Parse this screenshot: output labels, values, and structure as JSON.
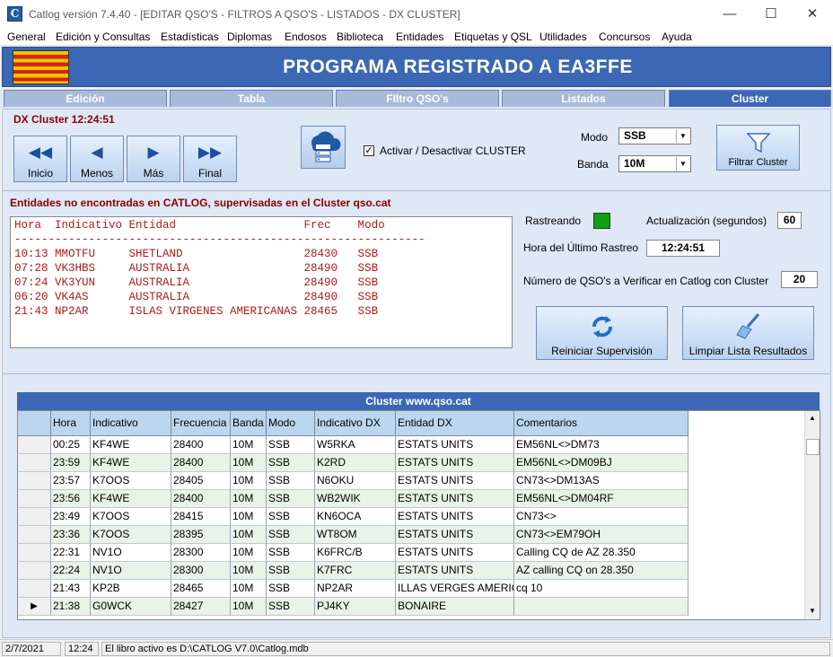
{
  "window": {
    "title": "Catlog versión 7.4.40 - [EDITAR QSO'S  - FILTROS A QSO'S - LISTADOS -  DX CLUSTER]",
    "app_icon": "C"
  },
  "menu": [
    "General",
    "Edición y Consultas",
    "Estadísticas",
    "Diplomas",
    "Endosos",
    "Biblioteca",
    "Entidades",
    "Etiquetas y QSL",
    "Utilidades",
    "Concursos",
    "Ayuda"
  ],
  "banner": {
    "title": "PROGRAMA REGISTRADO A EA3FFE"
  },
  "tabs": [
    "Edición",
    "Tabla",
    "FIltro QSO's",
    "Listados",
    "Cluster"
  ],
  "cluster": {
    "clock": "DX Cluster 12:24:51",
    "nav": {
      "first": "Inicio",
      "prev": "Menos",
      "next": "Más",
      "last": "Final"
    },
    "activate_label": "Activar / Desactivar CLUSTER",
    "mode_label": "Modo",
    "mode_value": "SSB",
    "band_label": "Banda",
    "band_value": "10M",
    "filter_button": "Filtrar Cluster"
  },
  "entities": {
    "title": "Entidades no encontradas en CATLOG, supervisadas en el Cluster qso.cat",
    "header": "Hora  Indicativo Entidad                   Frec    Modo",
    "separator": "-------------------------------------------------------------",
    "rows": [
      "10:13 MMOTFU     SHETLAND                  28430   SSB",
      "07:28 VK3HBS     AUSTRALIA                 28490   SSB",
      "07:24 VK3YUN     AUSTRALIA                 28490   SSB",
      "06:20 VK4AS      AUSTRALIA                 28490   SSB",
      "21:43 NP2AR      ISLAS VIRGENES AMERICANAS 28465   SSB"
    ]
  },
  "monitor": {
    "tracking_label": "Rastreando",
    "update_label": "Actualización (segundos)",
    "update_value": "60",
    "last_track_label": "Hora del Último Rastreo",
    "last_track_value": "12:24:51",
    "qso_check_label": "Número de QSO's a Verificar en Catlog con Cluster",
    "qso_check_value": "20",
    "restart_button": "Reiniciar Supervisión",
    "clear_button": "Limpiar Lista Resultados"
  },
  "grid": {
    "title": "Cluster www.qso.cat",
    "columns": [
      "Hora",
      "Indicativo",
      "Frecuencia",
      "Banda",
      "Modo",
      "Indicativo DX",
      "Entidad DX",
      "Comentarios"
    ],
    "rows": [
      [
        "00:25",
        "KF4WE",
        "28400",
        "10M",
        "SSB",
        "W5RKA",
        "ESTATS UNITS",
        "EM56NL<>DM73"
      ],
      [
        "23:59",
        "KF4WE",
        "28400",
        "10M",
        "SSB",
        "K2RD",
        "ESTATS UNITS",
        "EM56NL<>DM09BJ"
      ],
      [
        "23:57",
        "K7OOS",
        "28405",
        "10M",
        "SSB",
        "N6OKU",
        "ESTATS UNITS",
        "CN73<>DM13AS"
      ],
      [
        "23:56",
        "KF4WE",
        "28400",
        "10M",
        "SSB",
        "WB2WIK",
        "ESTATS UNITS",
        "EM56NL<>DM04RF"
      ],
      [
        "23:49",
        "K7OOS",
        "28415",
        "10M",
        "SSB",
        "KN6OCA",
        "ESTATS UNITS",
        "CN73<>"
      ],
      [
        "23:36",
        "K7OOS",
        "28395",
        "10M",
        "SSB",
        "WT8OM",
        "ESTATS UNITS",
        "CN73<>EM79OH"
      ],
      [
        "22:31",
        "NV1O",
        "28300",
        "10M",
        "SSB",
        "K6FRC/B",
        "ESTATS UNITS",
        "Calling CQ de AZ 28.350"
      ],
      [
        "22:24",
        "NV1O",
        "28300",
        "10M",
        "SSB",
        "K7FRC",
        "ESTATS UNITS",
        "AZ calling CQ on 28.350"
      ],
      [
        "21:43",
        "KP2B",
        "28465",
        "10M",
        "SSB",
        "NP2AR",
        "ILLAS VERGES AMERICA",
        "cq 10"
      ],
      [
        "21:38",
        "G0WCK",
        "28427",
        "10M",
        "SSB",
        "PJ4KY",
        "BONAIRE",
        ""
      ]
    ],
    "current_row_marker": "▶"
  },
  "status": {
    "date": "2/7/2021",
    "time": "12:24",
    "message": "El libro activo es D:\\CATLOG V7.0\\Catlog.mdb"
  },
  "colors": {
    "accent": "#3c67b4",
    "panel": "#dfe8f5",
    "alert_text": "#8b0000",
    "list_text": "#b01a1a",
    "led_on": "#10a010"
  }
}
